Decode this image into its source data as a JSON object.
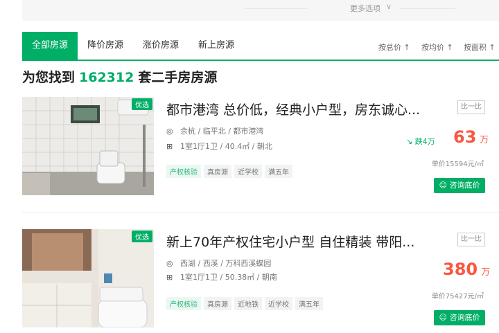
{
  "filters": {
    "more_label": "更多选项"
  },
  "tabs": [
    {
      "label": "全部房源"
    },
    {
      "label": "降价房源"
    },
    {
      "label": "涨价房源"
    },
    {
      "label": "新上房源"
    }
  ],
  "sort": [
    {
      "label": "按总价 ↑"
    },
    {
      "label": "按均价 ↑"
    },
    {
      "label": "按面积 ↑"
    }
  ],
  "result": {
    "prefix": "为您找到",
    "count": "162312",
    "suffix": "套二手房房源"
  },
  "listings": [
    {
      "badge": "优选",
      "title": "都市港湾 总价低，经典小户型，房东诚心...",
      "location": "余杭 / 临平北 / 都市港湾",
      "spec": "1室1厅1卫 / 40.4㎡ / 朝北",
      "tags": [
        "产权核验",
        "真房源",
        "近学校",
        "满五年"
      ],
      "price_change": "跌4万",
      "price": "63",
      "price_unit": "万",
      "unit_price": "单价15594元/㎡",
      "compare_label": "比一比",
      "ask_label": "咨询底价"
    },
    {
      "badge": "优选",
      "title": "新上70年产权住宅小户型 自住精装 带阳...",
      "location": "西湖 / 西溪 / 万科西溪蝶园",
      "spec": "1室1厅1卫 / 50.38㎡ / 朝南",
      "tags": [
        "产权核验",
        "真房源",
        "近地铁",
        "近学校",
        "满五年"
      ],
      "price": "380",
      "price_unit": "万",
      "unit_price": "单价75427元/㎡",
      "compare_label": "比一比",
      "ask_label": "咨询底价"
    }
  ],
  "colors": {
    "accent": "#00ae66",
    "price": "#fa5741"
  }
}
